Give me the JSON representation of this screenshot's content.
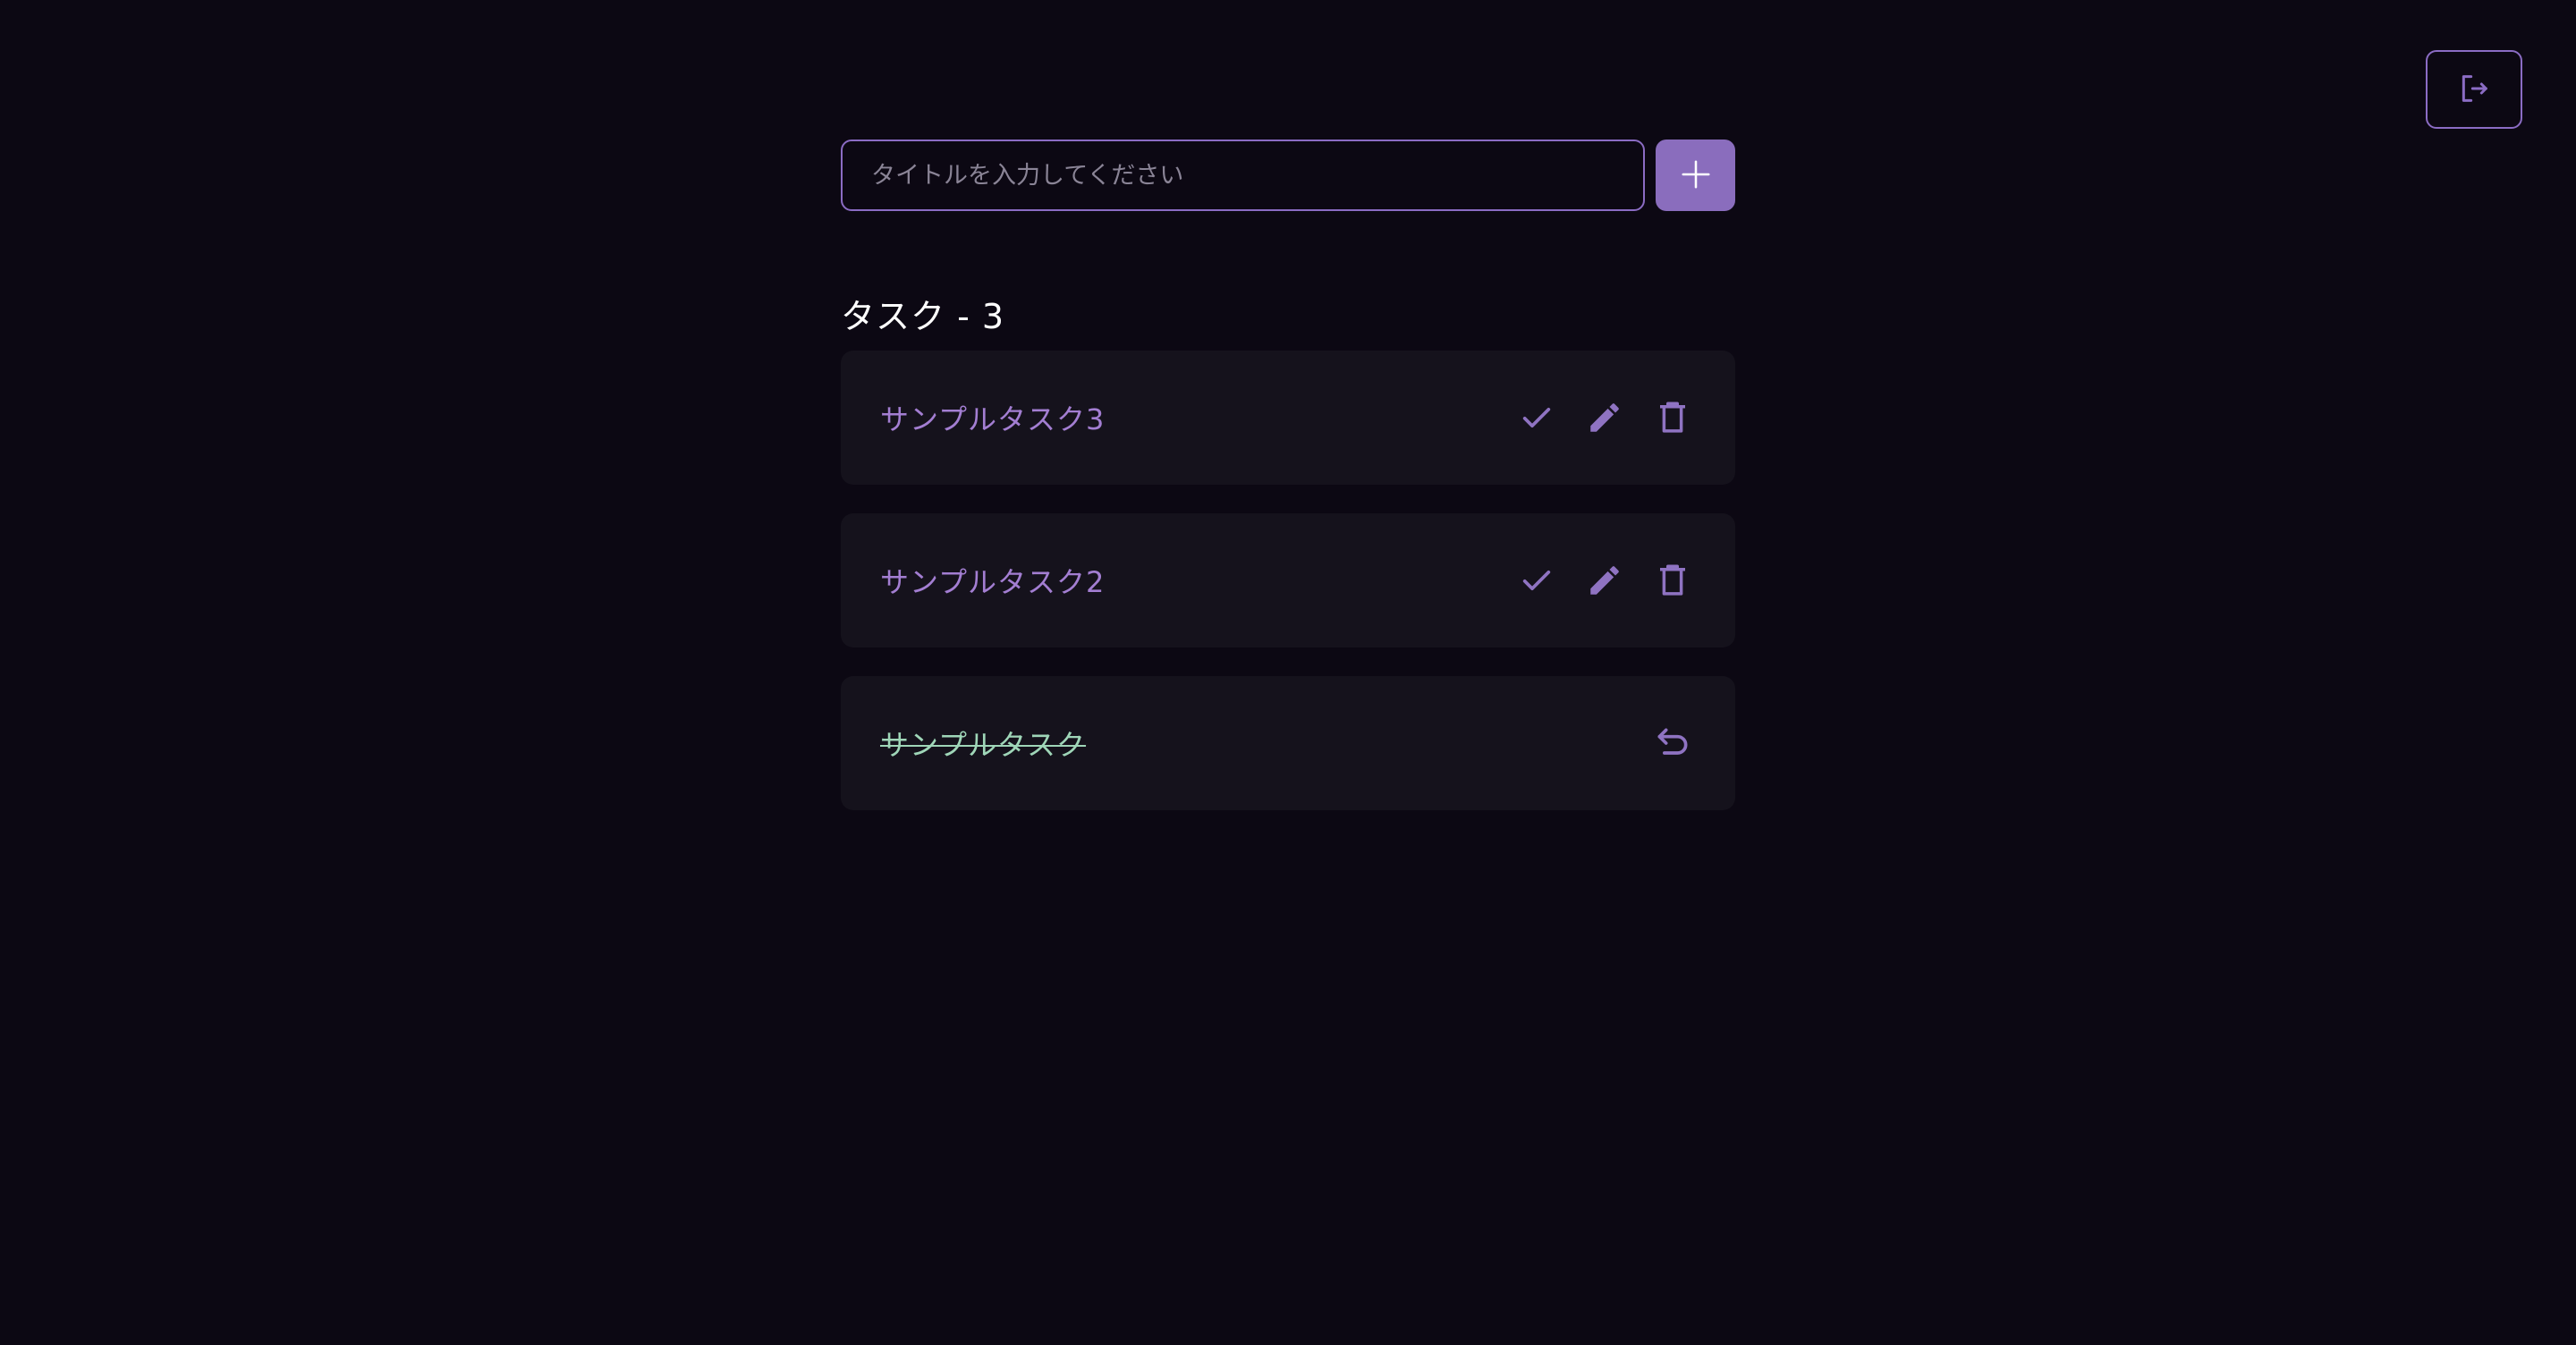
{
  "header": {
    "logout_icon": "logout-icon"
  },
  "form": {
    "placeholder": "タイトルを入力してください",
    "value": "",
    "add_icon": "plus-icon"
  },
  "tasks_section": {
    "heading": "タスク - 3"
  },
  "tasks": [
    {
      "title": "サンプルタスク3",
      "completed": false,
      "actions": [
        "check-icon",
        "pencil-icon",
        "trash-icon"
      ]
    },
    {
      "title": "サンプルタスク2",
      "completed": false,
      "actions": [
        "check-icon",
        "pencil-icon",
        "trash-icon"
      ]
    },
    {
      "title": "サンプルタスク",
      "completed": true,
      "actions": [
        "undo-icon"
      ]
    }
  ],
  "colors": {
    "background": "#0c0813",
    "card": "#15121c",
    "accent": "#8a6dbd",
    "task_text": "#a37ed2",
    "done_text": "#9fd6b8",
    "heading": "#ffffff"
  }
}
